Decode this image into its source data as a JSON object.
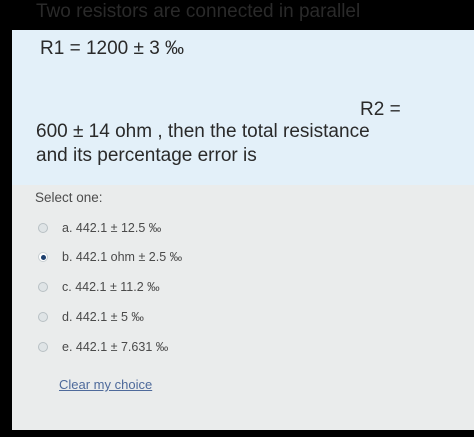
{
  "question": {
    "line1": "Two resistors are connected in parallel",
    "line2": "R1 = 1200 ± 3 ‰",
    "line3": "R2 =",
    "line4": "600 ± 14 ohm , then the total resistance",
    "line5": "and its percentage error is"
  },
  "answer": {
    "prompt": "Select one:",
    "options": [
      {
        "label": "a. 442.1 ± 12.5 ‰",
        "selected": false
      },
      {
        "label": "b. 442.1 ohm ± 2.5 ‰",
        "selected": true
      },
      {
        "label": "c. 442.1 ± 11.2 ‰",
        "selected": false
      },
      {
        "label": "d. 442.1 ± 5 ‰",
        "selected": false
      },
      {
        "label": "e. 442.1 ± 7.631 ‰",
        "selected": false
      }
    ],
    "clear_label": "Clear my choice"
  },
  "colors": {
    "question_bg": "#e3f0f9",
    "answer_bg": "#eaecec",
    "link": "#4e6a9b",
    "radio_selected": "#1d3f6e"
  }
}
